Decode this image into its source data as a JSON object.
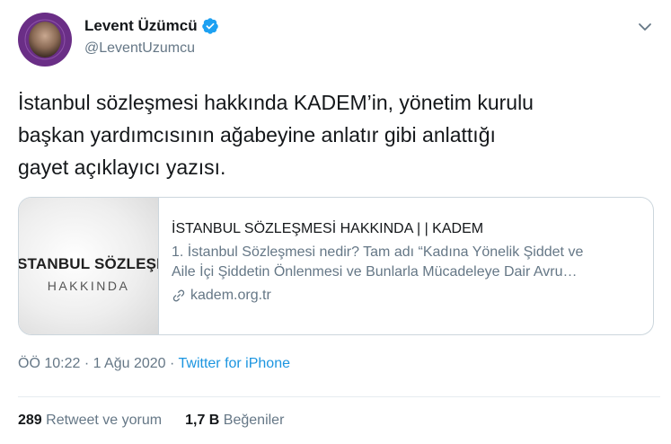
{
  "author": {
    "display_name": "Levent Üzümcü",
    "handle": "@LeventUzumcu",
    "verified": true,
    "avatar_icon": "avatar-photo"
  },
  "tweet": {
    "text_lines": [
      "İstanbul sözleşmesi hakkında KADEM’in, yönetim kurulu",
      "başkan yardımcısının ağabeyine anlatır gibi anlattığı",
      "gayet açıklayıcı yazısı."
    ]
  },
  "card": {
    "thumb_title": "STANBUL SÖZLEŞME",
    "thumb_subtitle": "HAKKINDA",
    "title": "İSTANBUL SÖZLEŞMESİ HAKKINDA | | KADEM",
    "description_lines": [
      "1. İstanbul Sözleşmesi nedir? Tam adı “Kadına Yönelik Şiddet ve",
      "Aile İçi Şiddetin Önlenmesi ve Bunlarla Mücadeleye Dair Avru…"
    ],
    "domain": "kadem.org.tr"
  },
  "meta": {
    "time": "ÖÖ 10:22",
    "separator": " · ",
    "date": "1 Ağu 2020",
    "source": "Twitter for iPhone"
  },
  "stats": {
    "retweets_count": "289",
    "retweets_label": "Retweet ve yorum",
    "likes_count": "1,7 B",
    "likes_label": "Beğeniler"
  },
  "colors": {
    "verified_blue": "#1da1f2",
    "link_blue": "#1b95e0",
    "secondary_text": "#657786",
    "avatar_purple": "#6a2e86"
  }
}
